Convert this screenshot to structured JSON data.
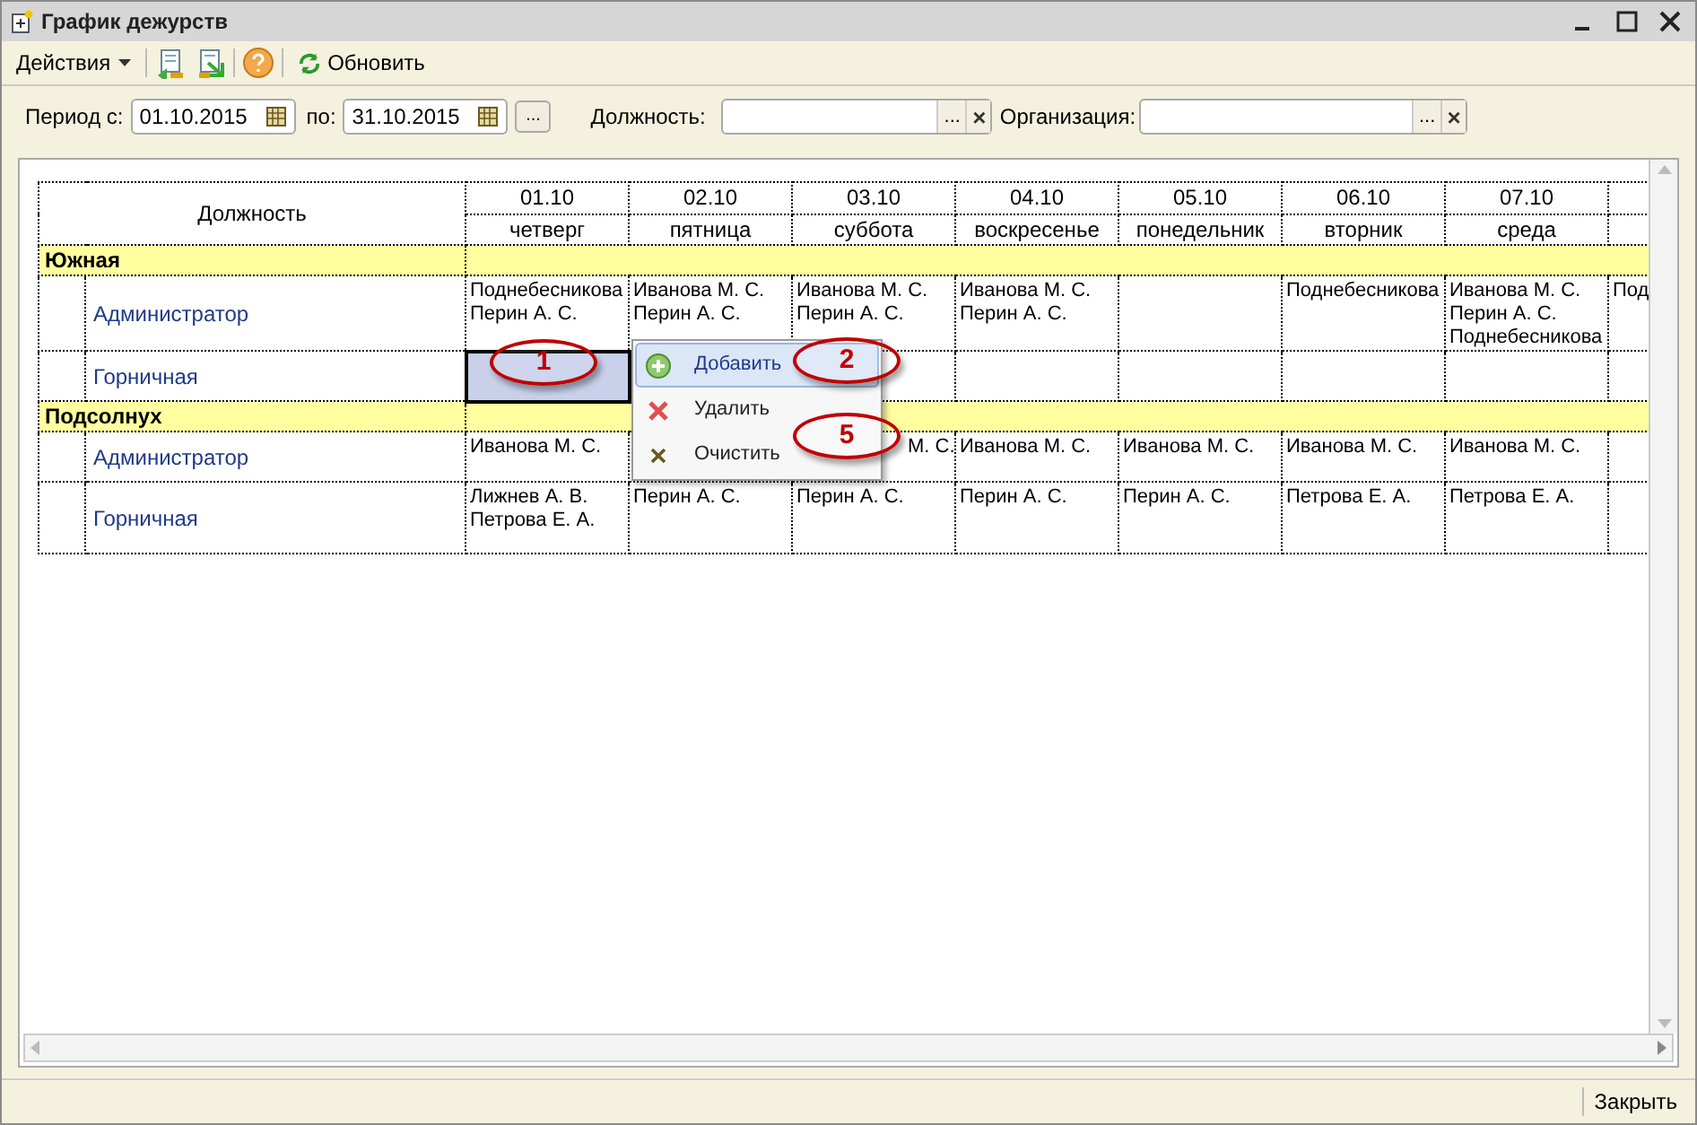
{
  "window": {
    "title": "График дежурств"
  },
  "toolbar": {
    "actions": "Действия",
    "refresh": "Обновить"
  },
  "filters": {
    "period_from_label": "Период с:",
    "period_from": "01.10.2015",
    "period_to_label": "по:",
    "period_to": "31.10.2015",
    "more": "...",
    "position_label": "Должность:",
    "organization_label": "Организация:",
    "select": "...",
    "clear": "×"
  },
  "table": {
    "position_header": "Должность",
    "columns": [
      {
        "date": "01.10",
        "weekday": "четверг"
      },
      {
        "date": "02.10",
        "weekday": "пятница"
      },
      {
        "date": "03.10",
        "weekday": "суббота"
      },
      {
        "date": "04.10",
        "weekday": "воскресенье"
      },
      {
        "date": "05.10",
        "weekday": "понедельник"
      },
      {
        "date": "06.10",
        "weekday": "вторник"
      },
      {
        "date": "07.10",
        "weekday": "среда"
      },
      {}
    ],
    "groups": [
      {
        "name": "Южная",
        "rows": [
          {
            "position": "Администратор",
            "cells": [
              {
                "text": "Поднебесникова\nПерин А. С.",
                "selected": false
              },
              {
                "text": "Иванова М. С.\nПерин А. С.",
                "selected": false
              },
              {
                "text": "Иванова М. С.\nПерин А. С.",
                "selected": false
              },
              {
                "text": "Иванова М. С.\nПерин А. С.",
                "selected": false
              },
              {
                "selected": false
              },
              {
                "text": "Поднебесникова",
                "selected": false
              },
              {
                "text": "Иванова М. С.\nПерин А. С.\nПоднебесникова",
                "selected": false
              },
              {
                "text": "Под",
                "selected": false
              }
            ]
          },
          {
            "position": "Горничная",
            "cells": [
              {
                "selected": true
              },
              {
                "selected": false
              },
              {
                "selected": false
              },
              {
                "selected": false
              },
              {
                "selected": false
              },
              {
                "selected": false
              },
              {
                "selected": false
              },
              {
                "selected": false
              }
            ]
          }
        ]
      },
      {
        "name": "Подсолнух",
        "rows": [
          {
            "position": "Администратор",
            "cells": [
              {
                "text": "Иванова М. С.",
                "selected": false
              },
              {
                "selected": false
              },
              {
                "text": "М. С.",
                "selected": false,
                "kind": "covered"
              },
              {
                "text": "Иванова М. С.",
                "selected": false
              },
              {
                "text": "Иванова М. С.",
                "selected": false
              },
              {
                "text": "Иванова М. С.",
                "selected": false
              },
              {
                "text": "Иванова М. С.",
                "selected": false
              },
              {
                "selected": false
              }
            ]
          },
          {
            "position": "Горничная",
            "cells": [
              {
                "text": "Лижнев А. В.\nПетрова Е. А.",
                "selected": false
              },
              {
                "text": "Перин А. С.",
                "selected": false
              },
              {
                "text": "Перин А. С.",
                "selected": false
              },
              {
                "text": "Перин А. С.",
                "selected": false
              },
              {
                "text": "Перин А. С.",
                "selected": false
              },
              {
                "text": "Петрова Е. А.",
                "selected": false
              },
              {
                "text": "Петрова Е. А.",
                "selected": false
              },
              {
                "selected": false
              }
            ]
          }
        ]
      }
    ]
  },
  "context_menu": [
    {
      "kind": "add",
      "label": "Добавить",
      "selected": true
    },
    {
      "kind": "delete",
      "label": "Удалить",
      "selected": false
    },
    {
      "kind": "clear",
      "label": "Очистить",
      "selected": false
    }
  ],
  "callouts": [
    "1",
    "2",
    "5"
  ],
  "footer": {
    "close": "Закрыть"
  }
}
